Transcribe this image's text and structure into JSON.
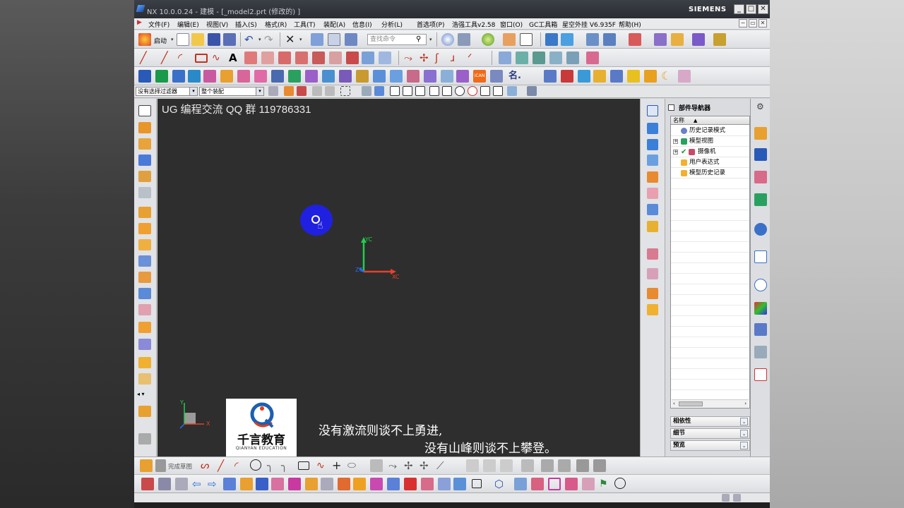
{
  "window": {
    "title": "NX 10.0.0.24 - 建模 - [_model2.prt  (修改的) ]",
    "brand": "SIEMENS",
    "controls": [
      "_",
      "□",
      "✕"
    ],
    "mdi_controls": [
      "−",
      "▭",
      "✕"
    ]
  },
  "menubar": {
    "items": [
      "文件(F)",
      "编辑(E)",
      "视图(V)",
      "插入(S)",
      "格式(R)",
      "工具(T)",
      "装配(A)",
      "信息(I)",
      "分析(L)",
      "首选项(P)",
      "浩强工具v2.58",
      "窗口(O)",
      "GC工具箱",
      "星空外挂 V6.935F",
      "帮助(H)"
    ]
  },
  "toolbar": {
    "start_label": "启动",
    "search_placeholder": "查找命令"
  },
  "selection_bar": {
    "filter": "没有选择过滤器",
    "scope": "整个装配"
  },
  "viewport": {
    "caption": "UG 编程交流 QQ 群 119786331",
    "axis_labels": {
      "yc": "YC",
      "xc": "XC",
      "zc": "ZC",
      "y": "Y",
      "x": "X"
    },
    "logo": {
      "title": "千言教育",
      "subtitle": "QIANYAN EDUCATION"
    },
    "subtitle_line1": "没有激流则谈不上勇进,",
    "subtitle_line2": "没有山峰则谈不上攀登。"
  },
  "navigator": {
    "title": "部件导航器",
    "column": "名称",
    "tree": [
      {
        "label": "历史记录模式",
        "expandable": false
      },
      {
        "label": "模型视图",
        "expandable": true
      },
      {
        "label": "摄像机",
        "expandable": true
      },
      {
        "label": "用户表达式",
        "expandable": false
      },
      {
        "label": "模型历史记录",
        "expandable": false
      }
    ],
    "sections": [
      "相依性",
      "细节",
      "预览"
    ]
  },
  "sketch_toolbar": {
    "finish_label": "完成草图"
  },
  "colors": {
    "viewport_bg": "#2e2e2e",
    "axis_y": "#1fd04a",
    "axis_x": "#e8402a",
    "axis_z": "#2a6cf0",
    "cursor_highlight": "#2020e0"
  }
}
